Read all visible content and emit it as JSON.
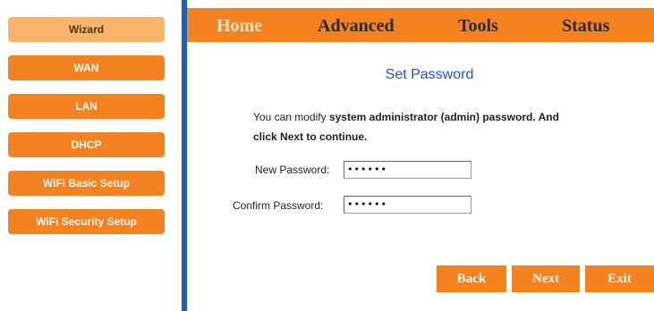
{
  "sidebar": {
    "items": [
      {
        "label": "Wizard"
      },
      {
        "label": "WAN"
      },
      {
        "label": "LAN"
      },
      {
        "label": "DHCP"
      },
      {
        "label": "WiFi Basic Setup"
      },
      {
        "label": "WiFi Security Setup"
      }
    ],
    "active_color": "#f9b46b",
    "color": "#f58220"
  },
  "nav": {
    "items": [
      {
        "label": "Home"
      },
      {
        "label": "Advanced"
      },
      {
        "label": "Tools"
      },
      {
        "label": "Status"
      }
    ],
    "bar_color": "#f58220",
    "divider_color": "#1f5fb7"
  },
  "main": {
    "title": "Set Password",
    "desc_part1": "You can modify ",
    "desc_bold1": "system administrator (admin) password. And",
    "desc_bold2": "click Next to continue.",
    "new_password_label": "New Password:",
    "new_password_value": "••••••",
    "confirm_password_label": "Confirm Password:",
    "confirm_password_value": "••••••"
  },
  "actions": {
    "back": "Back",
    "next": "Next",
    "exit": "Exit"
  }
}
